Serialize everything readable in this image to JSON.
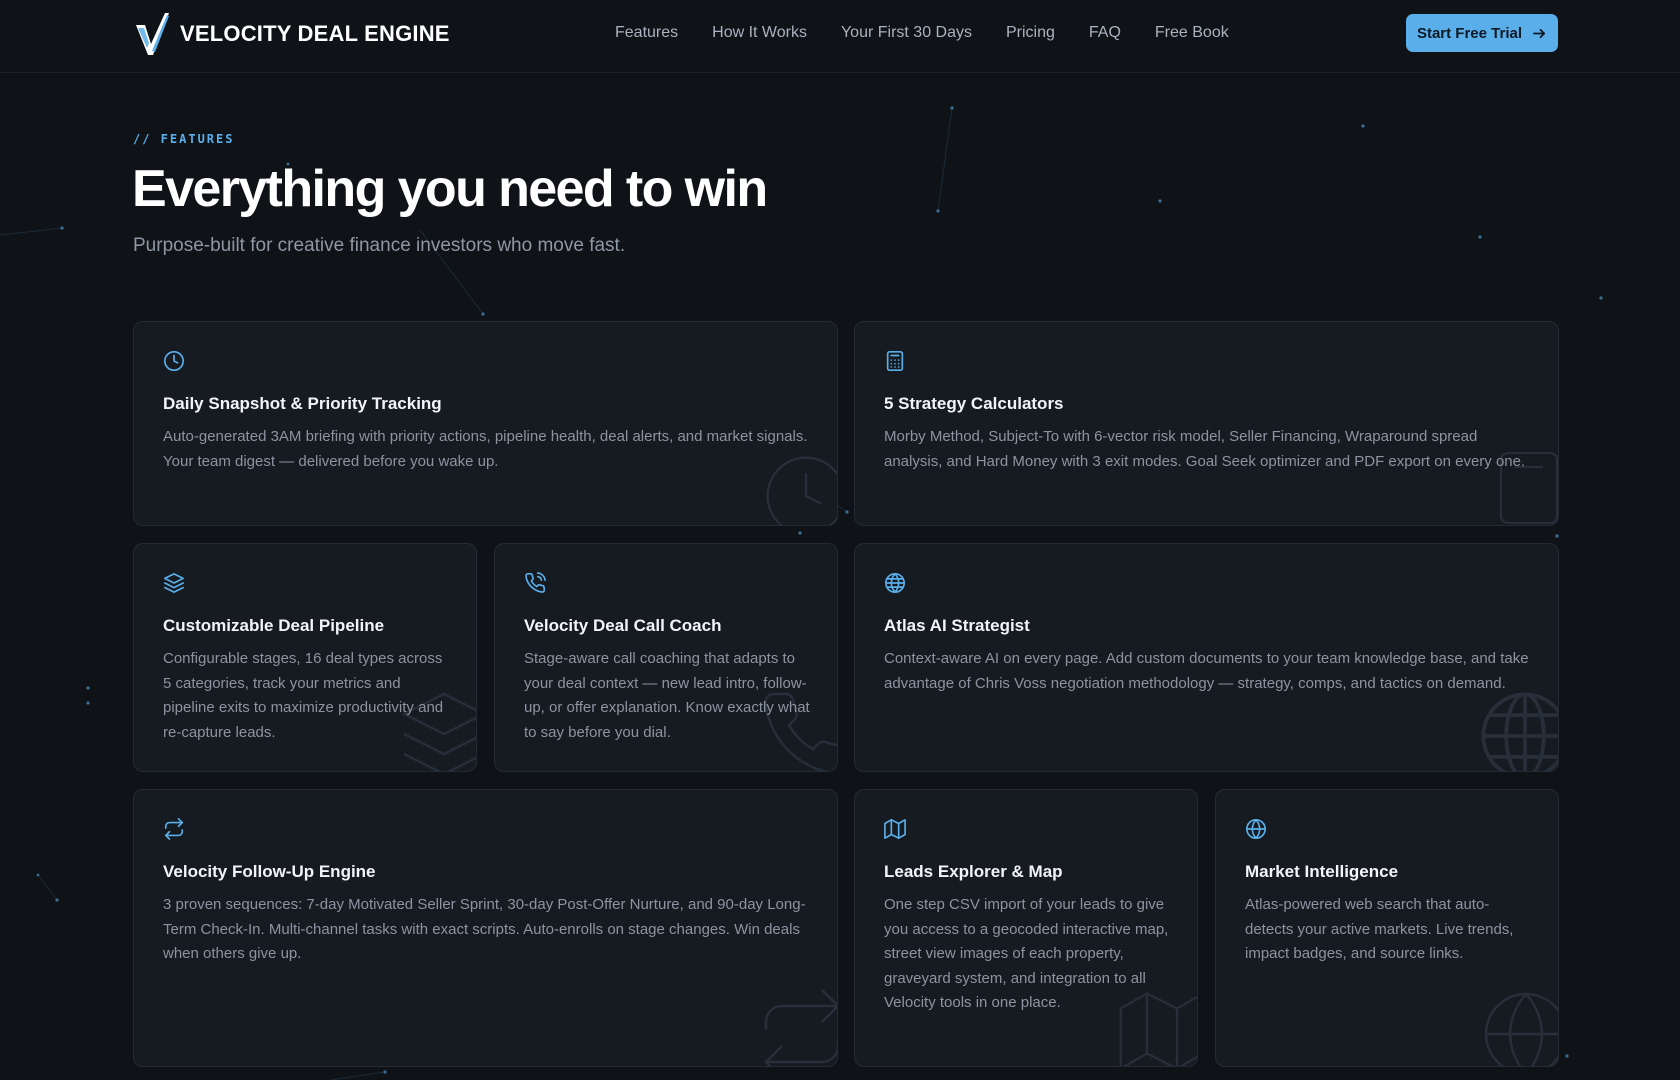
{
  "brand": {
    "name": "VELOCITY DEAL ENGINE",
    "logo_icon": "velocity-v-logo",
    "accent_color": "#5aaee9"
  },
  "nav": {
    "links": [
      "Features",
      "How It Works",
      "Your First 30 Days",
      "Pricing",
      "FAQ",
      "Free Book"
    ],
    "cta_label": "Start Free Trial",
    "cta_icon": "arrow-right-icon"
  },
  "hero": {
    "eyebrow": "// FEATURES",
    "title": "Everything you need to win",
    "subtitle": "Purpose-built for creative finance investors who move fast."
  },
  "features": [
    {
      "icon": "clock-icon",
      "title": "Daily Snapshot & Priority Tracking",
      "description": "Auto-generated 3AM briefing with priority actions, pipeline health, deal alerts, and market signals. Your team digest — delivered before you wake up."
    },
    {
      "icon": "calculator-icon",
      "title": "5 Strategy Calculators",
      "description": "Morby Method, Subject-To with 6-vector risk model, Seller Financing, Wraparound spread analysis, and Hard Money with 3 exit modes. Goal Seek optimizer and PDF export on every one."
    },
    {
      "icon": "layers-icon",
      "title": "Customizable Deal Pipeline",
      "description": "Configurable stages, 16 deal types across 5 categories, track your metrics and pipeline exits to maximize productivity and re-capture leads."
    },
    {
      "icon": "phone-call-icon",
      "title": "Velocity Deal Call Coach",
      "description": "Stage-aware call coaching that adapts to your deal context — new lead intro, follow-up, or offer explanation. Know exactly what to say before you dial."
    },
    {
      "icon": "globe-icon",
      "title": "Atlas AI Strategist",
      "description": "Context-aware AI on every page. Add custom documents to your team knowledge base, and take advantage of Chris Voss negotiation methodology — strategy, comps, and tactics on demand."
    },
    {
      "icon": "repeat-icon",
      "title": "Velocity Follow-Up Engine",
      "description": "3 proven sequences: 7-day Motivated Seller Sprint, 30-day Post-Offer Nurture, and 90-day Long-Term Check-In. Multi-channel tasks with exact scripts. Auto-enrolls on stage changes. Win deals when others give up."
    },
    {
      "icon": "map-icon",
      "title": "Leads Explorer & Map",
      "description": "One step CSV import of your leads to give you access to a geocoded interactive map, street view images of each property, graveyard system, and integration to all Velocity tools in one place."
    },
    {
      "icon": "globe-icon",
      "title": "Market Intelligence",
      "description": "Atlas-powered web search that auto-detects your active markets. Live trends, impact badges, and source links."
    }
  ]
}
